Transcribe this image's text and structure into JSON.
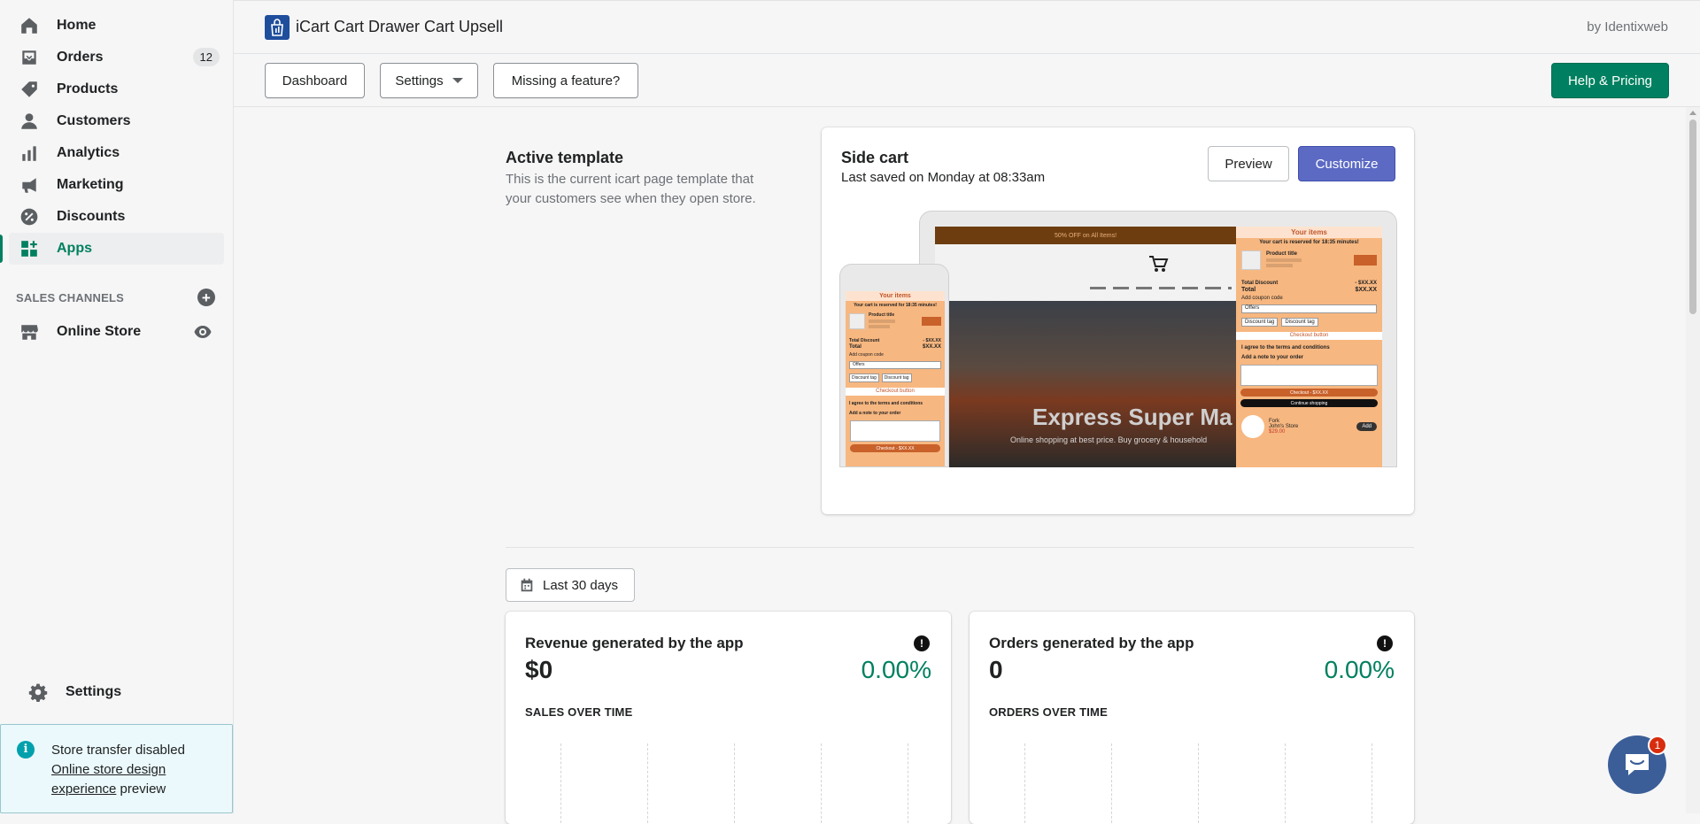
{
  "sidebar": {
    "items": [
      {
        "label": "Home",
        "icon": "home-icon"
      },
      {
        "label": "Orders",
        "icon": "orders-icon",
        "badge": "12"
      },
      {
        "label": "Products",
        "icon": "tag-icon"
      },
      {
        "label": "Customers",
        "icon": "person-icon"
      },
      {
        "label": "Analytics",
        "icon": "bar-chart-icon"
      },
      {
        "label": "Marketing",
        "icon": "megaphone-icon"
      },
      {
        "label": "Discounts",
        "icon": "discount-icon"
      },
      {
        "label": "Apps",
        "icon": "apps-icon",
        "active": true
      }
    ],
    "sales_channels_title": "SALES CHANNELS",
    "online_store": "Online Store",
    "settings": "Settings",
    "transfer": {
      "text": "Store transfer disabled",
      "link": "Online store design experience",
      "suffix": " preview"
    }
  },
  "header": {
    "app_title": "iCart Cart Drawer Cart Upsell",
    "by": "by Identixweb"
  },
  "toolbar": {
    "dashboard": "Dashboard",
    "settings": "Settings",
    "missing": "Missing a feature?",
    "help": "Help & Pricing"
  },
  "active_template": {
    "title": "Active template",
    "description": "This is the current icart page template that your customers see when they open store."
  },
  "side_cart": {
    "title": "Side cart",
    "saved": "Last saved on Monday at 08:33am",
    "preview": "Preview",
    "customize": "Customize",
    "mock": {
      "banner": "50% OFF on All Items!",
      "hero": "Express Super Ma",
      "hero_sub": "Online shopping at best price. Buy grocery & household",
      "drawer_title": "Your items",
      "reserved": "Your cart is reserved for 18:35 minutes!",
      "product_title": "Product title",
      "total_discount": "Total Discount",
      "total_discount_val": "- $XX.XX",
      "total": "Total",
      "total_val": "$XX.XX",
      "coupon": "Add coupon code",
      "offers": "Offers",
      "discount_tag": "Discount tag",
      "checkout_btn": "Checkout button",
      "agree": "I agree to the terms and conditions",
      "note": "Add a note to your order",
      "checkout": "Checkout - $XX.XX",
      "continue": "Continue shopping",
      "add": "Add",
      "upsell_name": "Fork",
      "upsell_store": "John's Store",
      "upsell_price": "$29.00"
    }
  },
  "date_range": "Last 30 days",
  "stats": [
    {
      "title": "Revenue generated by the app",
      "value": "$0",
      "pct": "0.00%",
      "sub": "SALES OVER TIME"
    },
    {
      "title": "Orders generated by the app",
      "value": "0",
      "pct": "0.00%",
      "sub": "ORDERS OVER TIME"
    }
  ],
  "chat": {
    "badge": "1"
  },
  "colors": {
    "accent": "#008060",
    "customize": "#5c6ac4"
  }
}
